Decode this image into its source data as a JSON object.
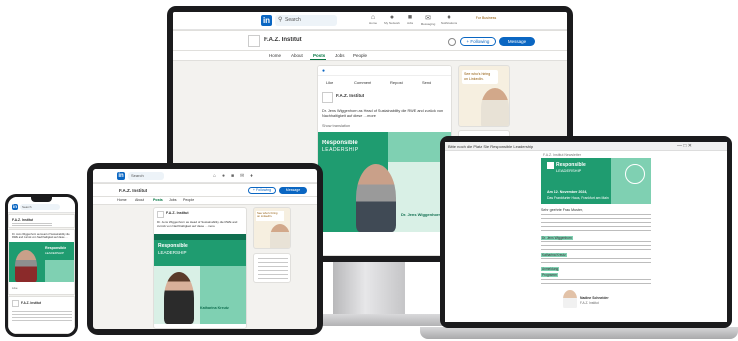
{
  "colors": {
    "linkedin_blue": "#0a66c2",
    "brand_green": "#1f9c70",
    "light_green": "#7fd0b2",
    "dark_green": "#0f6e4f",
    "feed_bg": "#f3f2ef"
  },
  "linkedin": {
    "logo": "in",
    "search_placeholder": "Search",
    "nav": [
      {
        "icon": "home-icon",
        "label": "Home"
      },
      {
        "icon": "network-icon",
        "label": "My Network"
      },
      {
        "icon": "jobs-icon",
        "label": "Jobs"
      },
      {
        "icon": "messaging-icon",
        "label": "Messaging"
      },
      {
        "icon": "notifications-icon",
        "label": "Notifications"
      }
    ],
    "for_business": "For Business",
    "company_name": "F.A.Z. Institut",
    "follow_label": "+ Following",
    "message_label": "Message",
    "tabs": [
      "Home",
      "About",
      "Posts",
      "Jobs",
      "People"
    ],
    "active_tab": "Posts",
    "post_author": "F.A.Z. Institut",
    "post_text": "Dr. Jens Wiggenhorn as Head of Sustainability die RWE and zurück von Nachhaltigkeit auf diese …more",
    "translation": "Show translation",
    "actions": [
      "Like",
      "Comment",
      "Repost",
      "Send"
    ],
    "hiring_line1": "See who's hiring",
    "hiring_line2": "on LinkedIn.",
    "rl_title_1": "Responsible",
    "rl_title_2": "LEADERSHIP",
    "speaker_monitor": "Dr. Jens Wiggenhorn",
    "speaker_tablet": "Katharina Kreutz"
  },
  "newsletter": {
    "subject": "Bitte noch die Platz Sie Responsible Leadership",
    "browser_title": "F.A.Z. Institut Newsletter",
    "brand_1": "Responsible",
    "brand_2": "LEADERSHIP",
    "date_line": "Am 12. November 2024,",
    "venue_line": "Das Frankfurter Haus, Frankfurt am Main",
    "greeting": "Sehr geehrte Frau Muster,",
    "highlight_1": "Dr. Jens Wiggenhorn",
    "highlight_2": "Katharina Kreutz",
    "highlight_3": "Anmeldung",
    "highlight_4": "Programm",
    "signature_name": "Nadine Schneider",
    "signature_role": "F.A.Z. Institut"
  }
}
